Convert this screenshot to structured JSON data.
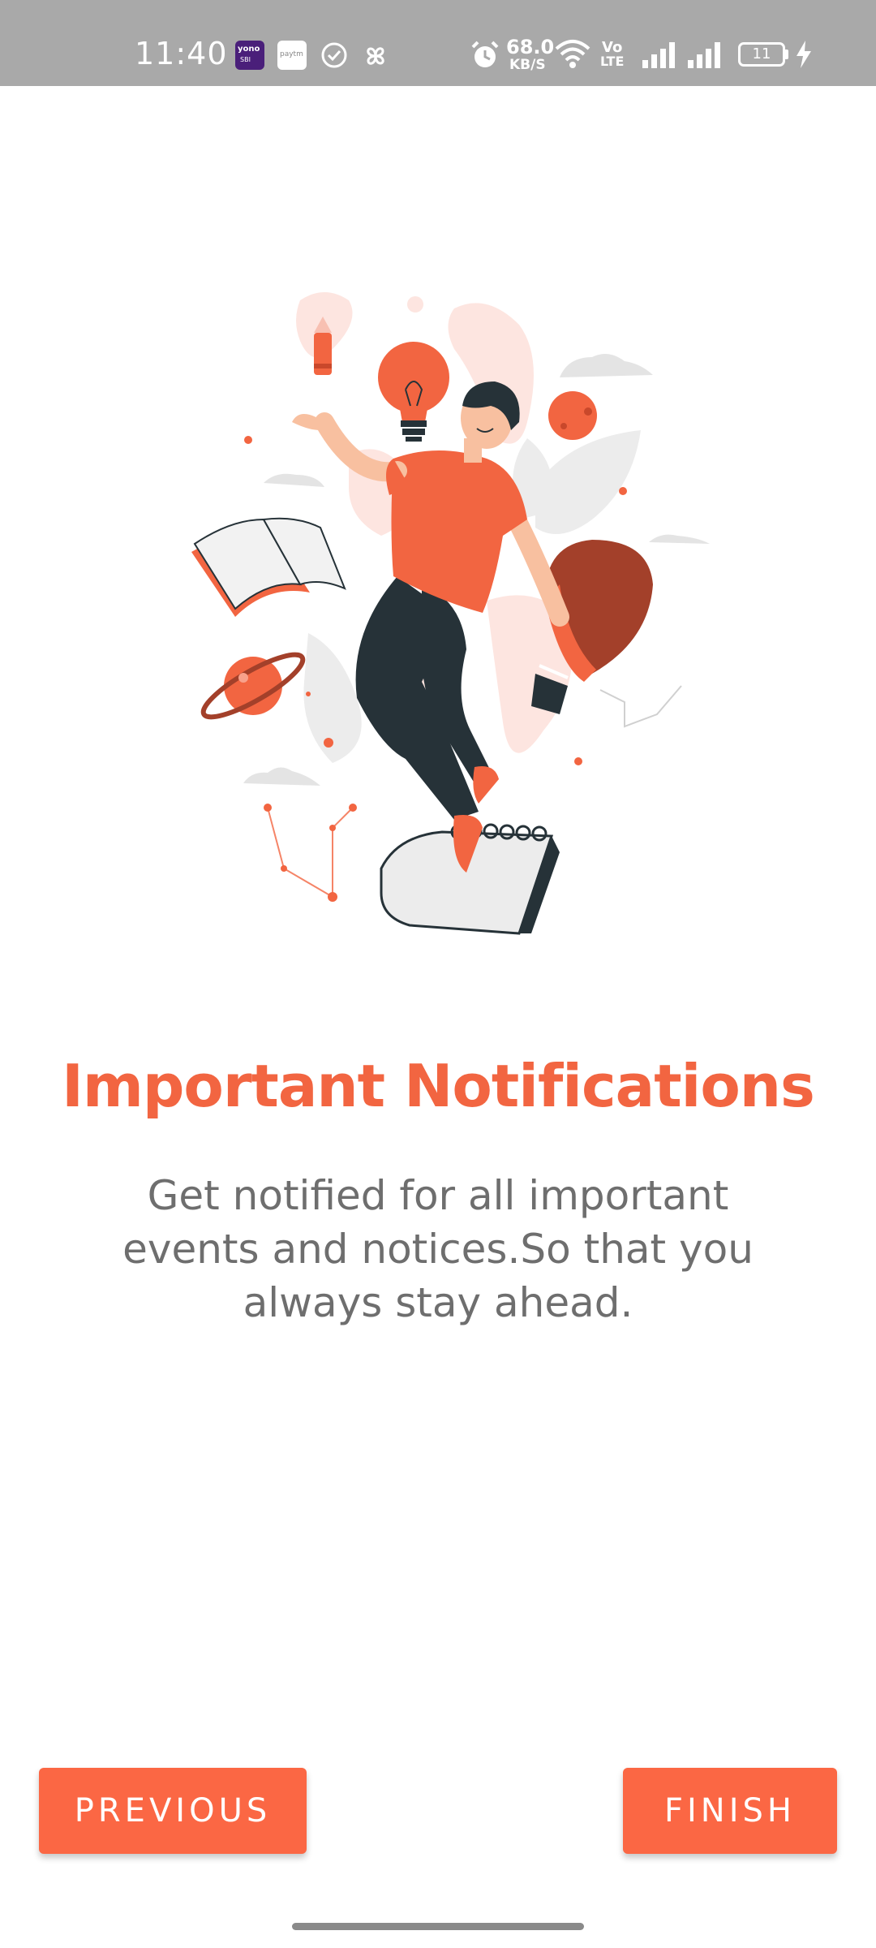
{
  "status_bar": {
    "time": "11:40",
    "network_speed_value": "68.0",
    "network_speed_unit": "KB/S",
    "volte_label": "Vo",
    "lte_label": "LTE",
    "battery_level": "11",
    "notification_icons": [
      "yono-sbi-app-icon",
      "paytm-app-icon",
      "check-circle-icon",
      "pinwheel-icon"
    ],
    "system_icons": [
      "alarm-icon",
      "wifi-icon",
      "signal-icon",
      "battery-icon",
      "charging-icon"
    ]
  },
  "illustration": {
    "icon": "person-floating-with-ideas-illustration",
    "accent_color": "#f26541"
  },
  "onboarding": {
    "title": "Important Notifications",
    "description": "Get notified for all important events and notices.So that you always stay ahead."
  },
  "buttons": {
    "previous_label": "PREVIOUS",
    "finish_label": "FINISH",
    "color": "#fb6744"
  }
}
